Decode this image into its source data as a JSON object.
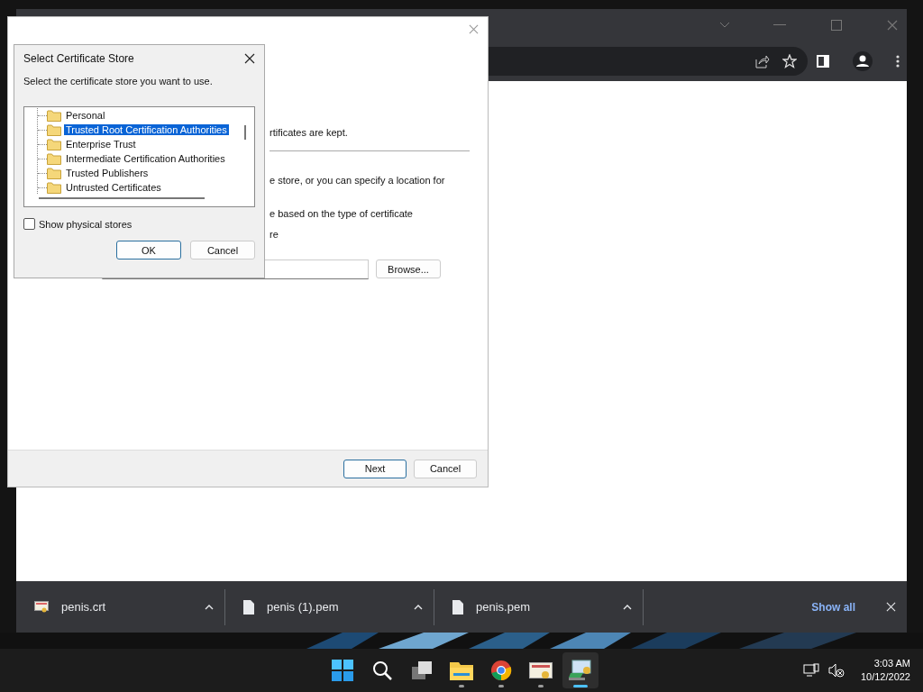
{
  "browser": {
    "download_bar": {
      "items": [
        {
          "name": "penis.crt",
          "kind": "certificate"
        },
        {
          "name": "penis (1).pem",
          "kind": "file"
        },
        {
          "name": "penis.pem",
          "kind": "file"
        }
      ],
      "show_all": "Show all"
    }
  },
  "wizard": {
    "texts": [
      "rtificates are kept.",
      "e store, or you can specify a location for",
      "e based on the type of certificate",
      "re"
    ],
    "browse": "Browse...",
    "next": "Next",
    "cancel": "Cancel"
  },
  "dialog": {
    "title": "Select Certificate Store",
    "prompt": "Select the certificate store you want to use.",
    "stores": [
      {
        "label": "Personal",
        "selected": false
      },
      {
        "label": "Trusted Root Certification Authorities",
        "selected": true
      },
      {
        "label": "Enterprise Trust",
        "selected": false
      },
      {
        "label": "Intermediate Certification Authorities",
        "selected": false
      },
      {
        "label": "Trusted Publishers",
        "selected": false
      },
      {
        "label": "Untrusted Certificates",
        "selected": false
      }
    ],
    "show_physical_stores": {
      "label": "Show physical stores",
      "checked": false
    },
    "ok": "OK",
    "cancel": "Cancel"
  },
  "taskbar": {
    "apps": [
      {
        "kind": "start",
        "running": false,
        "selected": false
      },
      {
        "kind": "search",
        "running": false,
        "selected": false
      },
      {
        "kind": "taskview",
        "running": false,
        "selected": false
      },
      {
        "kind": "explorer",
        "running": true,
        "selected": false
      },
      {
        "kind": "chrome",
        "running": true,
        "selected": false
      },
      {
        "kind": "certificate",
        "running": true,
        "selected": false
      },
      {
        "kind": "installer",
        "running": true,
        "selected": true
      }
    ],
    "time": "3:03 AM",
    "date": "10/12/2022"
  }
}
